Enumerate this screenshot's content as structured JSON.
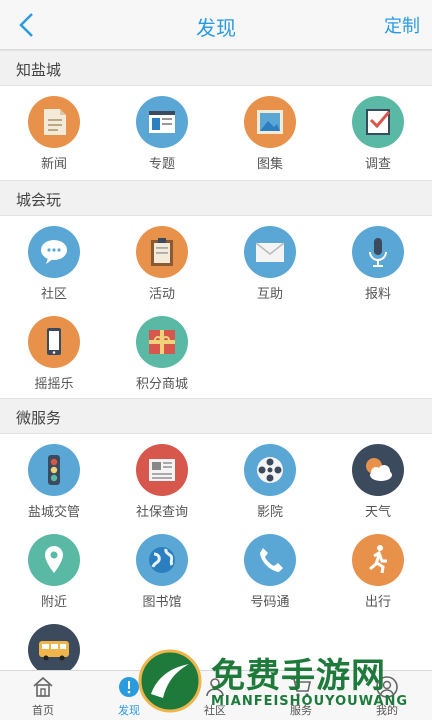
{
  "header": {
    "title": "发现",
    "right_action": "定制"
  },
  "sections": [
    {
      "title": "知盐城",
      "items": [
        "新闻",
        "专题",
        "图集",
        "调查"
      ]
    },
    {
      "title": "城会玩",
      "items": [
        "社区",
        "活动",
        "互助",
        "报料",
        "摇摇乐",
        "积分商城"
      ]
    },
    {
      "title": "微服务",
      "items": [
        "盐城交管",
        "社保查询",
        "影院",
        "天气",
        "附近",
        "图书馆",
        "号码通",
        "出行"
      ]
    }
  ],
  "tabbar": {
    "items": [
      "首页",
      "发现",
      "社区",
      "服务",
      "我的"
    ],
    "active": "发现"
  },
  "watermark": {
    "title": "免费手游网",
    "subtitle": "MIANFEISHOUYOUWANG"
  },
  "colors": {
    "accent": "#2b9be0",
    "orange": "#e8914b",
    "blue": "#5aa7d6",
    "teal": "#5ab9a5",
    "red": "#d8574c",
    "navy": "#3c4a5e"
  }
}
